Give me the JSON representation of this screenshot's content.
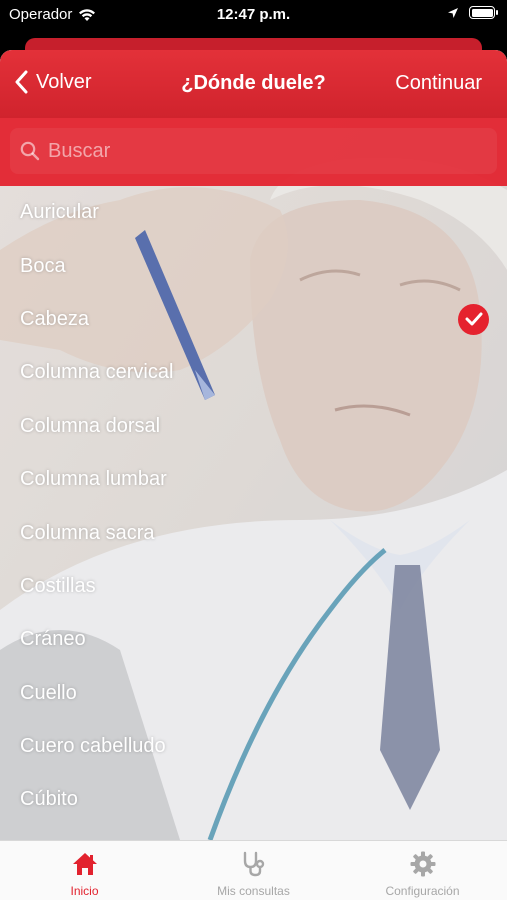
{
  "status_bar": {
    "carrier": "Operador",
    "time": "12:47 p.m.",
    "icons": [
      "wifi-icon",
      "location-arrow-icon",
      "battery-icon"
    ]
  },
  "nav": {
    "back_label": "Volver",
    "title": "¿Dónde duele?",
    "continue_label": "Continuar"
  },
  "search": {
    "placeholder": "Buscar",
    "value": ""
  },
  "list": {
    "items": [
      {
        "label": "Auricular",
        "selected": false
      },
      {
        "label": "Boca",
        "selected": false
      },
      {
        "label": "Cabeza",
        "selected": true
      },
      {
        "label": "Columna cervical",
        "selected": false
      },
      {
        "label": "Columna dorsal",
        "selected": false
      },
      {
        "label": "Columna lumbar",
        "selected": false
      },
      {
        "label": "Columna sacra",
        "selected": false
      },
      {
        "label": "Costillas",
        "selected": false
      },
      {
        "label": "Cráneo",
        "selected": false
      },
      {
        "label": "Cuello",
        "selected": false
      },
      {
        "label": "Cuero cabelludo",
        "selected": false
      },
      {
        "label": "Cúbito",
        "selected": false
      }
    ]
  },
  "tabs": [
    {
      "label": "Inicio",
      "icon": "home-icon",
      "active": true
    },
    {
      "label": "Mis consultas",
      "icon": "stethoscope-icon",
      "active": false
    },
    {
      "label": "Configuración",
      "icon": "gear-icon",
      "active": false
    }
  ],
  "colors": {
    "accent": "#E2222E",
    "tab_inactive": "#A7A7A7"
  }
}
